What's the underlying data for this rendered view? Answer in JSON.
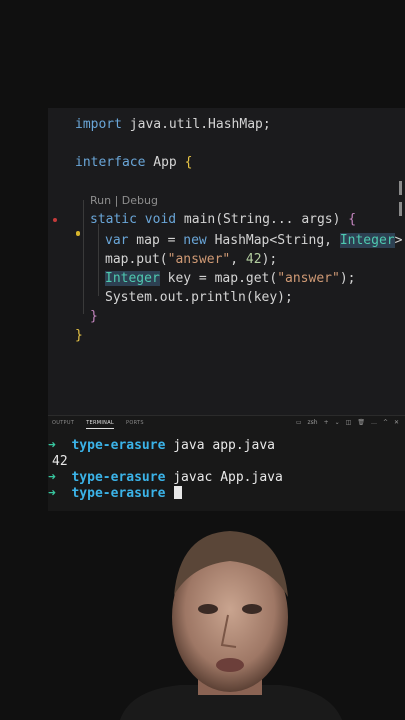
{
  "editor": {
    "lines": {
      "import": {
        "kw": "import",
        "rest": " java.util.HashMap;"
      },
      "interface": {
        "kw": "interface",
        "rest": " App ",
        "brace": "{"
      },
      "codelens": "Run | Debug",
      "main": {
        "kw": "static void",
        "rest": " main(String... args) ",
        "brace": "{"
      },
      "var": {
        "kw1": "var",
        "a": " map = ",
        "kw2": "new",
        "b": " HashMap<String, ",
        "type": "Integer",
        "c": ">"
      },
      "put": {
        "a": "map.put(",
        "str": "\"answer\"",
        "b": ", ",
        "num": "42",
        "c": ");"
      },
      "get": {
        "type": "Integer",
        "a": " key = map.get(",
        "str": "\"answer\"",
        "b": ");"
      },
      "print": {
        "a": "System.out.println(key);"
      },
      "close_main": "}",
      "close_iface": "}"
    }
  },
  "panel": {
    "tabs": [
      "OUTPUT",
      "TERMINAL",
      "PORTS"
    ],
    "active_tab": "TERMINAL",
    "shell_label": "zsh",
    "actions": [
      "+",
      "⌄",
      "◫",
      "🗑",
      "…",
      "^",
      "✕"
    ]
  },
  "terminal": {
    "prompt_arrow": "➜",
    "cwd": "type-erasure",
    "cmd1": "java app.java",
    "output1": "42",
    "cmd2": "javac App.java",
    "cmd3": ""
  },
  "colors": {
    "keyword": "#6aa6d8",
    "string": "#d09a75",
    "type": "#4ec9b0",
    "prompt_arrow": "#37c8a0",
    "cwd": "#3bb3e8"
  }
}
